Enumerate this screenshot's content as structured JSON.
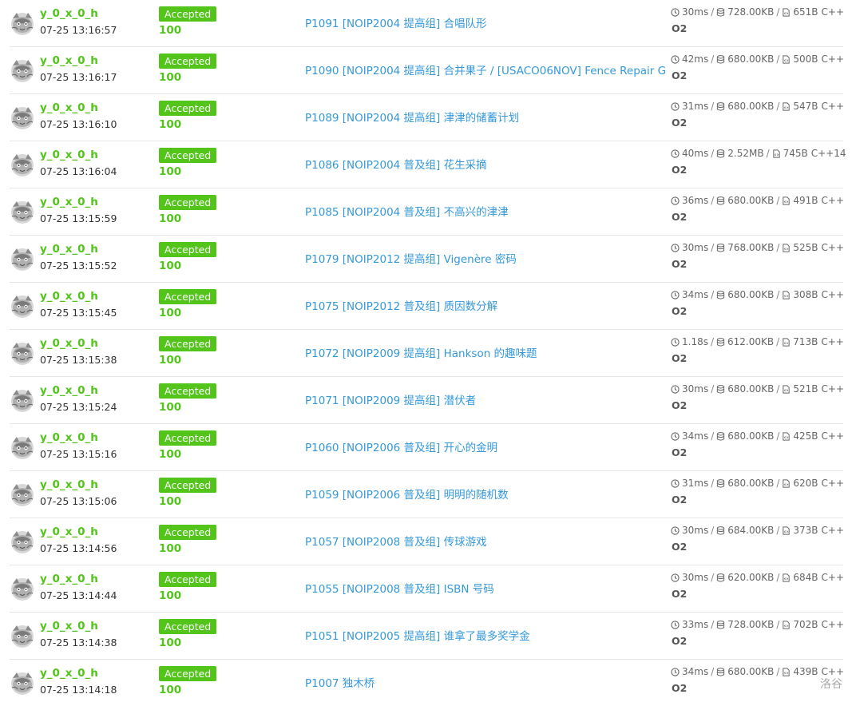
{
  "watermark": "洛谷",
  "colors": {
    "accent": "#52c41a",
    "link": "#3498db",
    "divider": "#e6e6e6"
  },
  "icons": {
    "avatar": "gray-cat-avatar-icon",
    "time": "clock-icon",
    "memory": "database-icon",
    "code": "file-code-icon"
  },
  "records": [
    {
      "user": "y_0_x_0_h",
      "time": "07-25 13:16:57",
      "status": "Accepted",
      "score": "100",
      "problem": "P1091 [NOIP2004 提高组] 合唱队形",
      "runtime": "30ms",
      "memory": "728.00KB",
      "code": "651B",
      "lang": "C++",
      "opt": "O2"
    },
    {
      "user": "y_0_x_0_h",
      "time": "07-25 13:16:17",
      "status": "Accepted",
      "score": "100",
      "problem": "P1090 [NOIP2004 提高组] 合并果子 / [USACO06NOV] Fence Repair G",
      "runtime": "42ms",
      "memory": "680.00KB",
      "code": "500B",
      "lang": "C++",
      "opt": "O2"
    },
    {
      "user": "y_0_x_0_h",
      "time": "07-25 13:16:10",
      "status": "Accepted",
      "score": "100",
      "problem": "P1089 [NOIP2004 提高组] 津津的储蓄计划",
      "runtime": "31ms",
      "memory": "680.00KB",
      "code": "547B",
      "lang": "C++",
      "opt": "O2"
    },
    {
      "user": "y_0_x_0_h",
      "time": "07-25 13:16:04",
      "status": "Accepted",
      "score": "100",
      "problem": "P1086 [NOIP2004 普及组] 花生采摘",
      "runtime": "40ms",
      "memory": "2.52MB",
      "code": "745B",
      "lang": "C++14",
      "opt": "O2"
    },
    {
      "user": "y_0_x_0_h",
      "time": "07-25 13:15:59",
      "status": "Accepted",
      "score": "100",
      "problem": "P1085 [NOIP2004 普及组] 不高兴的津津",
      "runtime": "36ms",
      "memory": "680.00KB",
      "code": "491B",
      "lang": "C++",
      "opt": "O2"
    },
    {
      "user": "y_0_x_0_h",
      "time": "07-25 13:15:52",
      "status": "Accepted",
      "score": "100",
      "problem": "P1079 [NOIP2012 提高组] Vigenère 密码",
      "runtime": "30ms",
      "memory": "768.00KB",
      "code": "525B",
      "lang": "C++",
      "opt": "O2"
    },
    {
      "user": "y_0_x_0_h",
      "time": "07-25 13:15:45",
      "status": "Accepted",
      "score": "100",
      "problem": "P1075 [NOIP2012 普及组] 质因数分解",
      "runtime": "34ms",
      "memory": "680.00KB",
      "code": "308B",
      "lang": "C++",
      "opt": "O2"
    },
    {
      "user": "y_0_x_0_h",
      "time": "07-25 13:15:38",
      "status": "Accepted",
      "score": "100",
      "problem": "P1072 [NOIP2009 提高组] Hankson 的趣味题",
      "runtime": "1.18s",
      "memory": "612.00KB",
      "code": "713B",
      "lang": "C++",
      "opt": "O2"
    },
    {
      "user": "y_0_x_0_h",
      "time": "07-25 13:15:24",
      "status": "Accepted",
      "score": "100",
      "problem": "P1071 [NOIP2009 提高组] 潜伏者",
      "runtime": "30ms",
      "memory": "680.00KB",
      "code": "521B",
      "lang": "C++",
      "opt": "O2"
    },
    {
      "user": "y_0_x_0_h",
      "time": "07-25 13:15:16",
      "status": "Accepted",
      "score": "100",
      "problem": "P1060 [NOIP2006 普及组] 开心的金明",
      "runtime": "34ms",
      "memory": "680.00KB",
      "code": "425B",
      "lang": "C++",
      "opt": "O2"
    },
    {
      "user": "y_0_x_0_h",
      "time": "07-25 13:15:06",
      "status": "Accepted",
      "score": "100",
      "problem": "P1059 [NOIP2006 普及组] 明明的随机数",
      "runtime": "31ms",
      "memory": "680.00KB",
      "code": "620B",
      "lang": "C++",
      "opt": "O2"
    },
    {
      "user": "y_0_x_0_h",
      "time": "07-25 13:14:56",
      "status": "Accepted",
      "score": "100",
      "problem": "P1057 [NOIP2008 普及组] 传球游戏",
      "runtime": "30ms",
      "memory": "684.00KB",
      "code": "373B",
      "lang": "C++",
      "opt": "O2"
    },
    {
      "user": "y_0_x_0_h",
      "time": "07-25 13:14:44",
      "status": "Accepted",
      "score": "100",
      "problem": "P1055 [NOIP2008 普及组] ISBN 号码",
      "runtime": "30ms",
      "memory": "620.00KB",
      "code": "684B",
      "lang": "C++",
      "opt": "O2"
    },
    {
      "user": "y_0_x_0_h",
      "time": "07-25 13:14:38",
      "status": "Accepted",
      "score": "100",
      "problem": "P1051 [NOIP2005 提高组] 谁拿了最多奖学金",
      "runtime": "33ms",
      "memory": "728.00KB",
      "code": "702B",
      "lang": "C++",
      "opt": "O2"
    },
    {
      "user": "y_0_x_0_h",
      "time": "07-25 13:14:18",
      "status": "Accepted",
      "score": "100",
      "problem": "P1007 独木桥",
      "runtime": "34ms",
      "memory": "680.00KB",
      "code": "439B",
      "lang": "C++",
      "opt": "O2"
    }
  ]
}
